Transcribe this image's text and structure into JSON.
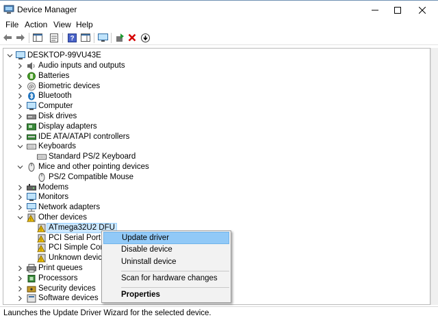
{
  "window": {
    "title": "Device Manager",
    "controls": {
      "minimize": "—",
      "maximize": "☐",
      "close": "✕"
    }
  },
  "menu": [
    "File",
    "Action",
    "View",
    "Help"
  ],
  "toolbar": {
    "icons": [
      "back-arrow-icon",
      "forward-arrow-icon",
      "console-tree-icon",
      "properties-icon",
      "help-icon",
      "action-pane-icon",
      "monitor-scan-icon",
      "update-driver-icon",
      "uninstall-x-icon",
      "download-icon"
    ],
    "colors": {
      "red": "#d60000",
      "green": "#1f9b31",
      "blue": "#1e73be"
    }
  },
  "tree": {
    "root": "DESKTOP-99VU43E",
    "items": [
      {
        "label": "Audio inputs and outputs",
        "level": 1,
        "expanded": false,
        "icon": "speaker-icon"
      },
      {
        "label": "Batteries",
        "level": 1,
        "expanded": false,
        "icon": "battery-icon"
      },
      {
        "label": "Biometric devices",
        "level": 1,
        "expanded": false,
        "icon": "fingerprint-icon"
      },
      {
        "label": "Bluetooth",
        "level": 1,
        "expanded": false,
        "icon": "bluetooth-icon"
      },
      {
        "label": "Computer",
        "level": 1,
        "expanded": false,
        "icon": "computer-icon"
      },
      {
        "label": "Disk drives",
        "level": 1,
        "expanded": false,
        "icon": "disk-drive-icon"
      },
      {
        "label": "Display adapters",
        "level": 1,
        "expanded": false,
        "icon": "display-adapter-icon"
      },
      {
        "label": "IDE ATA/ATAPI controllers",
        "level": 1,
        "expanded": false,
        "icon": "ide-controller-icon"
      },
      {
        "label": "Keyboards",
        "level": 1,
        "expanded": true,
        "icon": "keyboard-icon"
      },
      {
        "label": "Standard PS/2 Keyboard",
        "level": 2,
        "icon": "keyboard-icon"
      },
      {
        "label": "Mice and other pointing devices",
        "level": 1,
        "expanded": true,
        "icon": "mouse-icon"
      },
      {
        "label": "PS/2 Compatible Mouse",
        "level": 2,
        "icon": "mouse-icon"
      },
      {
        "label": "Modems",
        "level": 1,
        "expanded": false,
        "icon": "modem-icon"
      },
      {
        "label": "Monitors",
        "level": 1,
        "expanded": false,
        "icon": "monitor-icon"
      },
      {
        "label": "Network adapters",
        "level": 1,
        "expanded": false,
        "icon": "network-adapter-icon"
      },
      {
        "label": "Other devices",
        "level": 1,
        "expanded": true,
        "icon": "unknown-device-icon"
      },
      {
        "label": "ATmega32U2 DFU",
        "level": 2,
        "icon": "warning-device-icon",
        "selected": true
      },
      {
        "label": "PCI Serial Port",
        "level": 2,
        "icon": "warning-device-icon"
      },
      {
        "label": "PCI Simple Comm",
        "level": 2,
        "icon": "warning-device-icon"
      },
      {
        "label": "Unknown device",
        "level": 2,
        "icon": "warning-device-icon"
      },
      {
        "label": "Print queues",
        "level": 1,
        "expanded": false,
        "icon": "printer-icon"
      },
      {
        "label": "Processors",
        "level": 1,
        "expanded": false,
        "icon": "processor-icon"
      },
      {
        "label": "Security devices",
        "level": 1,
        "expanded": false,
        "icon": "security-device-icon"
      },
      {
        "label": "Software devices",
        "level": 1,
        "expanded": false,
        "icon": "software-device-icon"
      }
    ]
  },
  "context_menu": {
    "update_driver": "Update driver",
    "disable_device": "Disable device",
    "uninstall_device": "Uninstall device",
    "scan_hardware": "Scan for hardware changes",
    "properties": "Properties",
    "highlight": "#91c9f7"
  },
  "status": "Launches the Update Driver Wizard for the selected device."
}
